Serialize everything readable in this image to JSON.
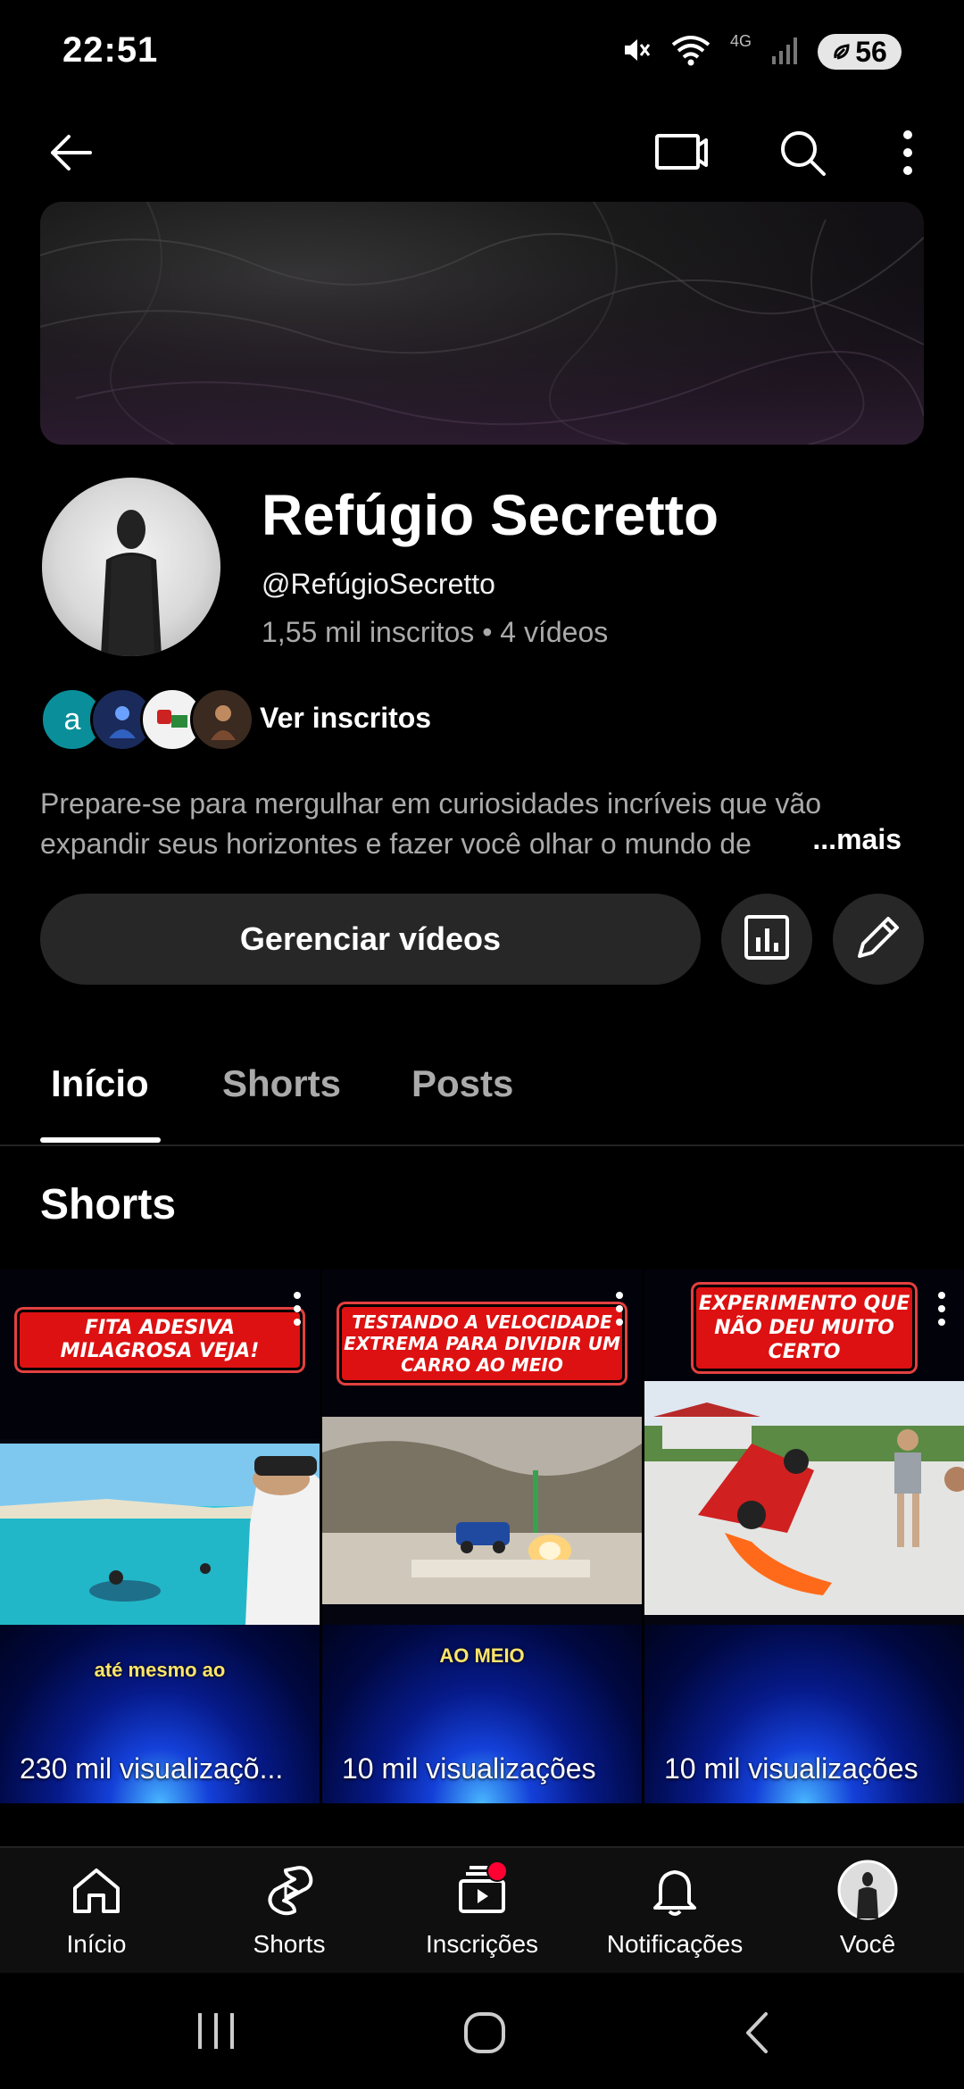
{
  "status_bar": {
    "time": "22:51",
    "network": "4G",
    "battery": "56",
    "icons": [
      "mute-icon",
      "wifi-icon",
      "signal-icon",
      "battery-icon"
    ]
  },
  "app_bar": {
    "icons": [
      "back-arrow-icon",
      "cast-icon",
      "search-icon",
      "more-vert-icon"
    ]
  },
  "channel": {
    "name": "Refúgio Secretto",
    "handle": "@RefúgioSecretto",
    "stats": "1,55 mil inscritos • 4 vídeos",
    "subscribers_label": "Ver inscritos",
    "subscriber_avatar_letter": "a",
    "description": "Prepare-se para mergulhar em curiosidades incríveis que vão expandir seus horizontes e fazer você olhar o mundo de",
    "more_label": "...mais"
  },
  "actions": {
    "manage_label": "Gerenciar vídeos",
    "analytics_icon": "analytics-icon",
    "edit_icon": "pencil-icon"
  },
  "tabs": [
    {
      "label": "Início",
      "active": true
    },
    {
      "label": "Shorts",
      "active": false
    },
    {
      "label": "Posts",
      "active": false
    }
  ],
  "section": {
    "title": "Shorts"
  },
  "shorts": [
    {
      "caption": "FITA ADESIVA MILAGROSA VEJA!",
      "overlay": "até mesmo ao",
      "views": "230 mil visualizaçõ..."
    },
    {
      "caption": "TESTANDO A VELOCIDADE EXTREMA PARA DIVIDIR UM CARRO AO MEIO",
      "overlay": "AO MEIO",
      "views": "10 mil visualizações"
    },
    {
      "caption": "EXPERIMENTO QUE NÃO DEU MUITO CERTO",
      "overlay": "",
      "views": "10 mil visualizações"
    }
  ],
  "bottom_nav": [
    {
      "label": "Início",
      "icon": "home-icon"
    },
    {
      "label": "Shorts",
      "icon": "shorts-icon"
    },
    {
      "label": "Inscrições",
      "icon": "subscriptions-icon"
    },
    {
      "label": "Notificações",
      "icon": "bell-icon"
    },
    {
      "label": "Você",
      "icon": "profile-avatar-icon"
    }
  ],
  "system_nav": {
    "icons": [
      "recents-icon",
      "home-circle-icon",
      "system-back-icon"
    ]
  },
  "colors": {
    "background": "#000000",
    "surface": "#272727",
    "secondary_text": "#aaaaaa",
    "accent_red": "#ff0033"
  }
}
